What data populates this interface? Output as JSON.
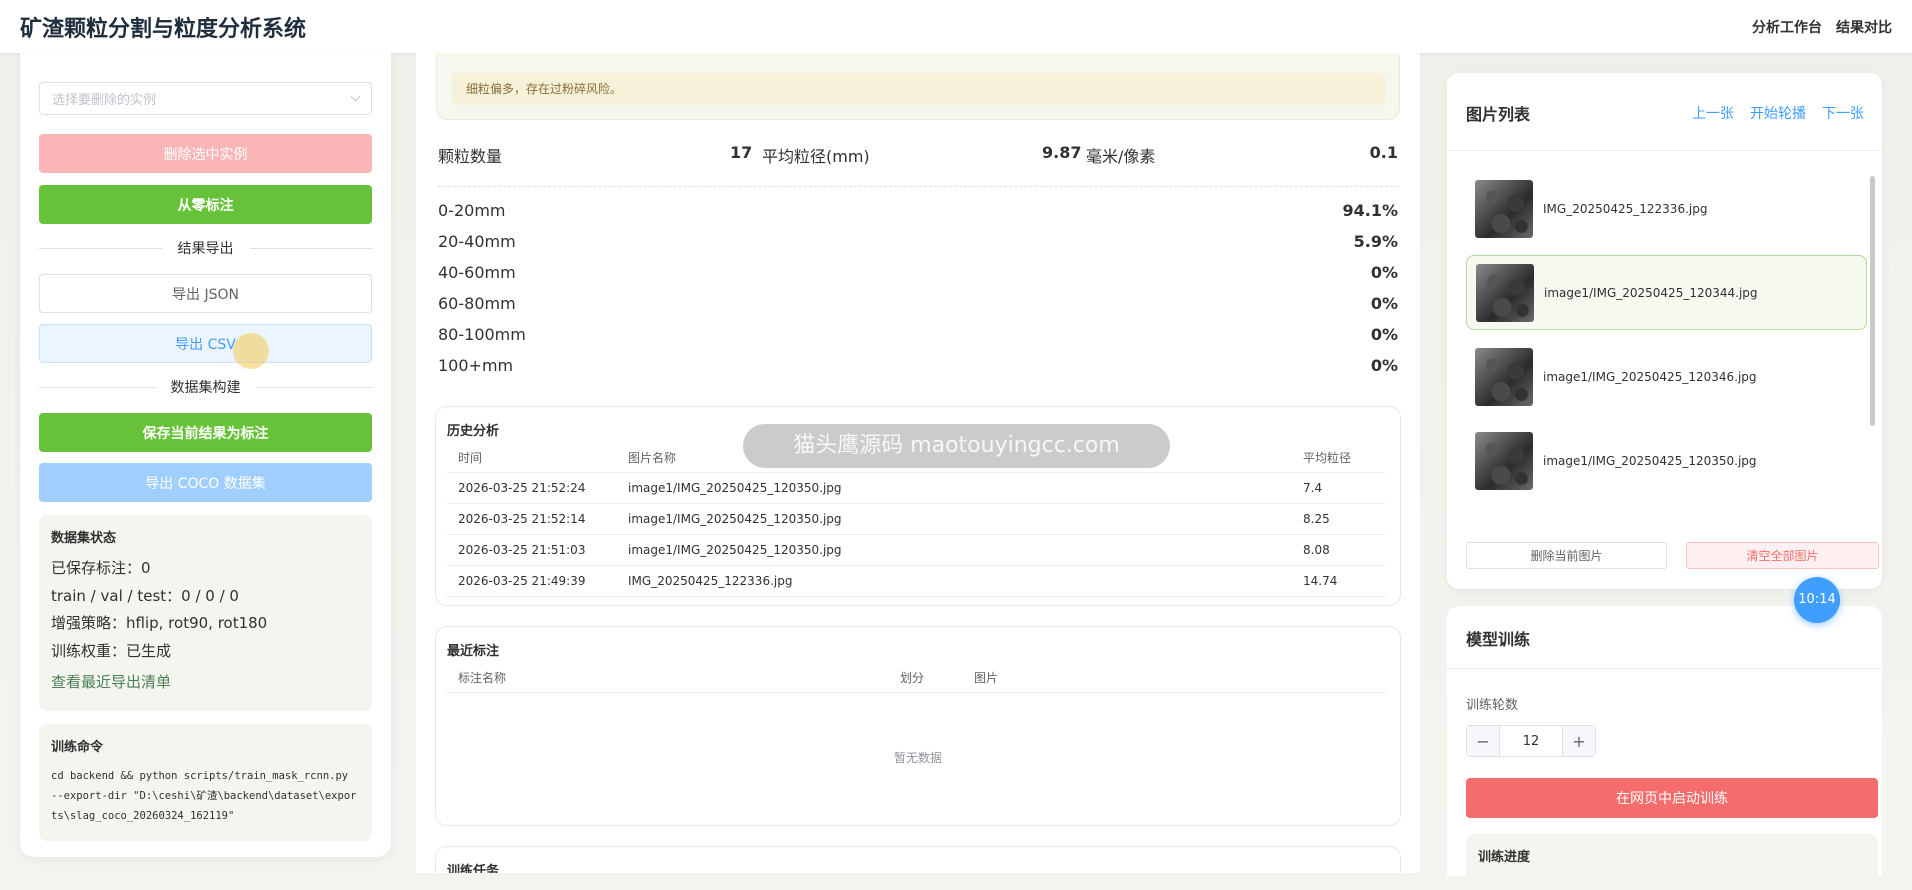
{
  "header": {
    "title": "矿渣颗粒分割与粒度分析系统",
    "nav": [
      "分析工作台",
      "结果对比"
    ]
  },
  "left": {
    "select_placeholder": "选择要删除的实例",
    "delete_selected": "删除选中实例",
    "annotate_from_scratch": "从零标注",
    "export_divider": "结果导出",
    "export_json": "导出 JSON",
    "export_csv": "导出 CSV",
    "dataset_divider": "数据集构建",
    "save_as_annotation": "保存当前结果为标注",
    "export_coco": "导出 COCO 数据集",
    "dataset_status": {
      "title": "数据集状态",
      "lines": [
        "已保存标注：0",
        "train / val / test：0 / 0 / 0",
        "增强策略：hflip, rot90, rot180",
        "训练权重：已生成"
      ],
      "link": "查看最近导出清单"
    },
    "train_cmd": {
      "title": "训练命令",
      "text": "cd backend && python scripts/train_mask_rcnn.py --export-dir \"D:\\ceshi\\矿渣\\backend\\dataset\\exports\\slag_coco_20260324_162119\""
    }
  },
  "middle": {
    "warning": "细粒偏多，存在过粉碎风险。",
    "stats": {
      "count_label": "颗粒数量",
      "count_value": "17",
      "mean_label": "平均粒径(mm)",
      "mean_value": "9.87",
      "scale_label": "毫米/像素",
      "scale_value": "0.1"
    },
    "distribution": [
      {
        "label": "0-20mm",
        "value": "94.1%"
      },
      {
        "label": "20-40mm",
        "value": "5.9%"
      },
      {
        "label": "40-60mm",
        "value": "0%"
      },
      {
        "label": "60-80mm",
        "value": "0%"
      },
      {
        "label": "80-100mm",
        "value": "0%"
      },
      {
        "label": "100+mm",
        "value": "0%"
      }
    ],
    "history": {
      "title": "历史分析",
      "columns": [
        "时间",
        "图片名称",
        "平均粒径"
      ],
      "rows": [
        [
          "2026-03-25 21:52:24",
          "image1/IMG_20250425_120350.jpg",
          "7.4"
        ],
        [
          "2026-03-25 21:52:14",
          "image1/IMG_20250425_120350.jpg",
          "8.25"
        ],
        [
          "2026-03-25 21:51:03",
          "image1/IMG_20250425_120350.jpg",
          "8.08"
        ],
        [
          "2026-03-25 21:49:39",
          "IMG_20250425_122336.jpg",
          "14.74"
        ]
      ]
    },
    "recent": {
      "title": "最近标注",
      "columns": [
        "标注名称",
        "划分",
        "图片"
      ],
      "empty": "暂无数据"
    },
    "train_tasks": {
      "title": "训练任务"
    },
    "watermark": "猫头鹰源码 maotouyingcc.com"
  },
  "right": {
    "image_list": {
      "title": "图片列表",
      "prev": "上一张",
      "play": "开始轮播",
      "next": "下一张",
      "items": [
        "IMG_20250425_122336.jpg",
        "image1/IMG_20250425_120344.jpg",
        "image1/IMG_20250425_120346.jpg",
        "image1/IMG_20250425_120350.jpg"
      ],
      "delete_current": "删除当前图片",
      "clear_all": "清空全部图片"
    },
    "timer": "10:14",
    "training": {
      "title": "模型训练",
      "epochs_label": "训练轮数",
      "epochs_value": "12",
      "start": "在网页中启动训练",
      "progress_title": "训练进度"
    }
  }
}
